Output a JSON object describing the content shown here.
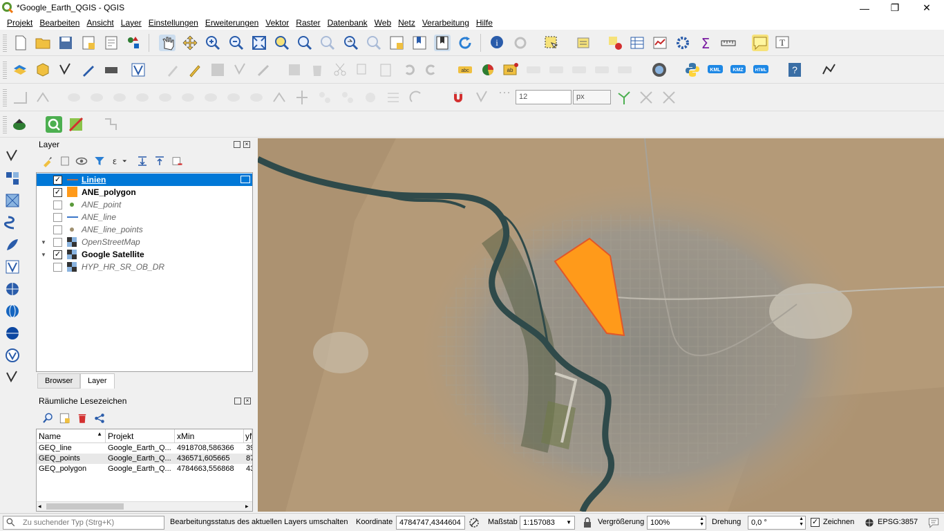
{
  "window": {
    "title": "*Google_Earth_QGIS - QGIS",
    "minimize": "—",
    "maximize": "❐",
    "close": "✕"
  },
  "menu": [
    "Projekt",
    "Bearbeiten",
    "Ansicht",
    "Layer",
    "Einstellungen",
    "Erweiterungen",
    "Vektor",
    "Raster",
    "Datenbank",
    "Web",
    "Netz",
    "Verarbeitung",
    "Hilfe"
  ],
  "toolbar": {
    "snapping_tolerance": "12",
    "snapping_unit": "px"
  },
  "layers_panel": {
    "title": "Layer",
    "items": [
      {
        "name": "Linien",
        "checked": true,
        "selected": true,
        "icon": "line-icon",
        "style": "bold-underline"
      },
      {
        "name": "ANE_polygon",
        "checked": true,
        "icon": "polygon-icon",
        "style": "bold"
      },
      {
        "name": "ANE_point",
        "checked": false,
        "icon": "point-icon",
        "style": "italic"
      },
      {
        "name": "ANE_line",
        "checked": false,
        "icon": "line-icon",
        "style": "italic"
      },
      {
        "name": "ANE_line_points",
        "checked": false,
        "icon": "point-icon",
        "style": "italic"
      },
      {
        "name": "OpenStreetMap",
        "checked": false,
        "icon": "raster-icon",
        "style": "italic"
      },
      {
        "name": "Google Satellite",
        "checked": true,
        "icon": "raster-icon",
        "style": "bold"
      },
      {
        "name": "HYP_HR_SR_OB_DR",
        "checked": false,
        "icon": "raster-icon",
        "style": "italic"
      }
    ],
    "tabs": [
      "Browser",
      "Layer"
    ],
    "check_mark": "✓"
  },
  "bookmarks_panel": {
    "title": "Räumliche Lesezeichen",
    "columns": [
      "Name",
      "Projekt",
      "xMin",
      "yM"
    ],
    "rows": [
      [
        "GEQ_line",
        "Google_Earth_Q...",
        "4918708,586366",
        "39"
      ],
      [
        "GEQ_points",
        "Google_Earth_Q...",
        "436571,605665",
        "87"
      ],
      [
        "GEQ_polygon",
        "Google_Earth_Q...",
        "4784663,556868",
        "43"
      ]
    ]
  },
  "status": {
    "search_placeholder": "Zu suchender Typ (Strg+K)",
    "message": "Bearbeitungsstatus des aktuellen Layers umschalten",
    "coord_label": "Koordinate",
    "coord_value": "4784747,4344604",
    "scale_label": "Maßstab",
    "scale_value": "1:157083",
    "magnifier_label": "Vergrößerung",
    "magnifier_value": "100%",
    "rotation_label": "Drehung",
    "rotation_value": "0,0 °",
    "render_label": "Zeichnen",
    "crs": "EPSG:3857"
  },
  "colors": {
    "accent": "#0078d7",
    "polygon_fill": "#ff9a1a",
    "polygon_stroke": "#e0572a"
  }
}
